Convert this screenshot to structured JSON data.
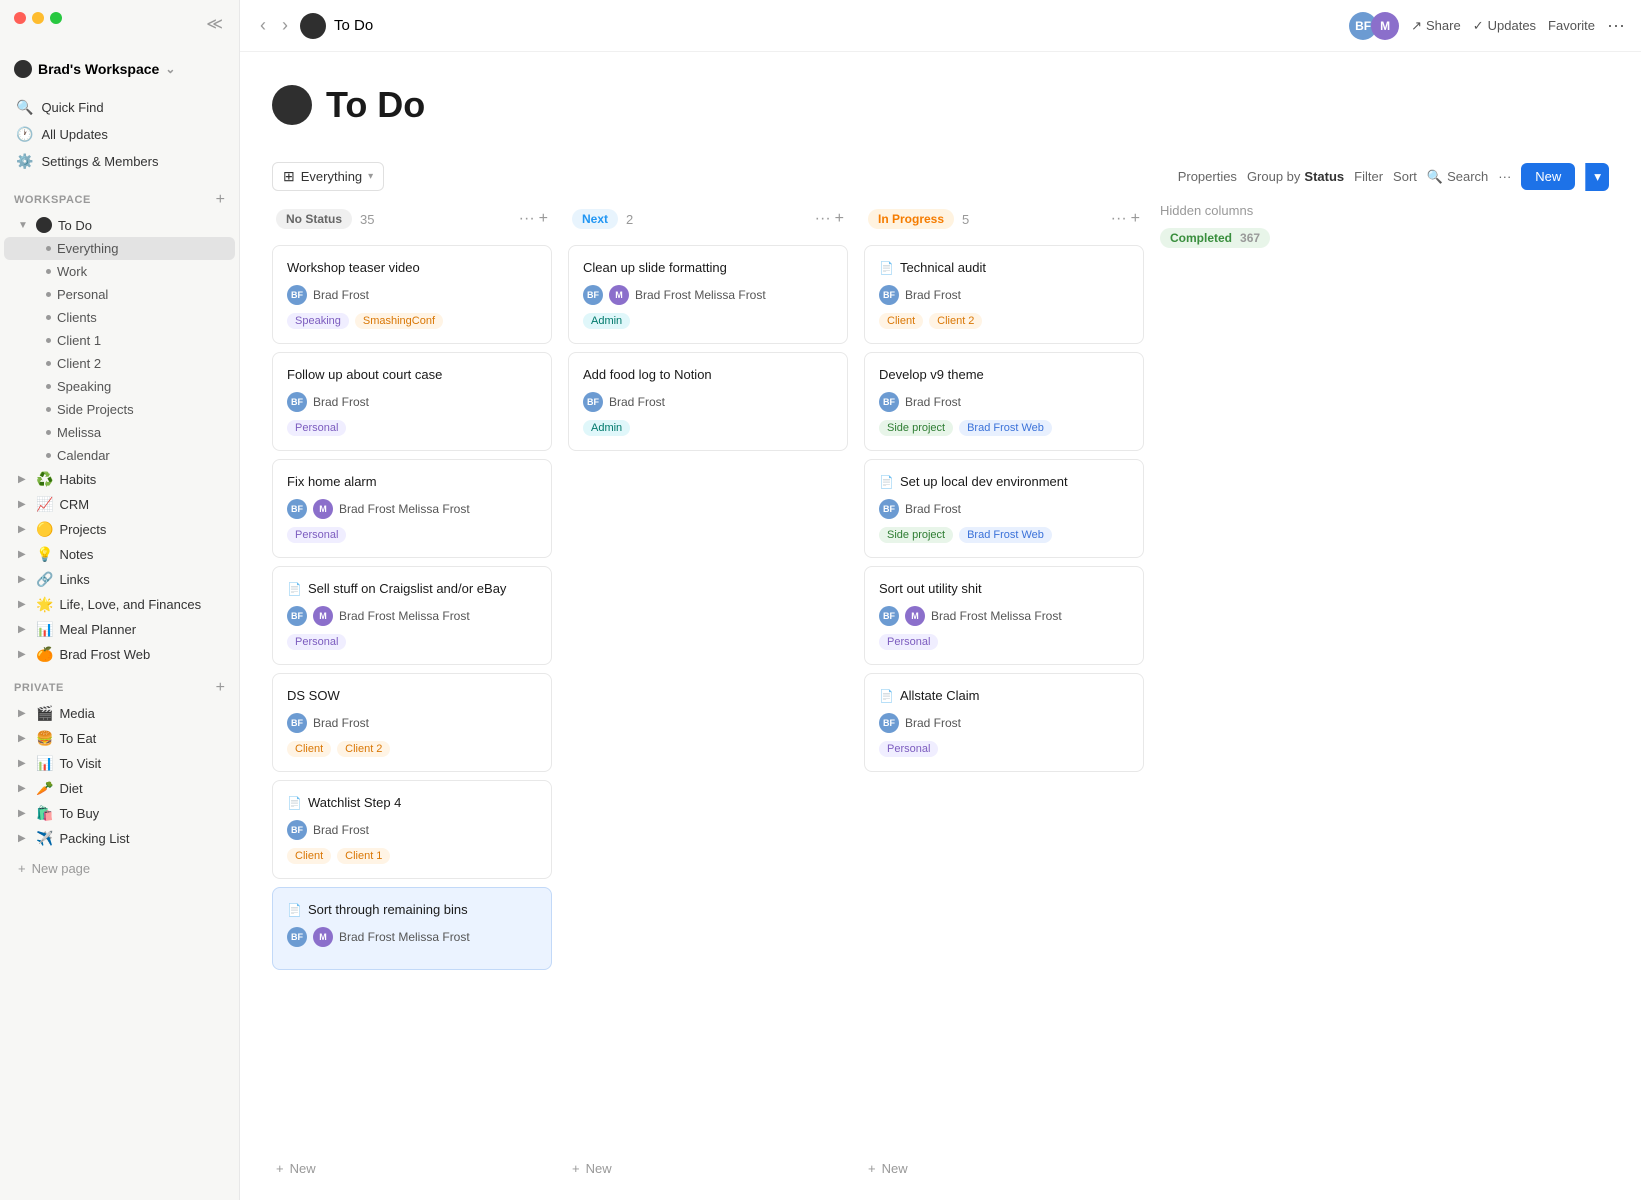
{
  "sidebar": {
    "workspace": "Brad's Workspace",
    "nav": [
      {
        "id": "quick-find",
        "icon": "🔍",
        "label": "Quick Find"
      },
      {
        "id": "all-updates",
        "icon": "🕐",
        "label": "All Updates"
      },
      {
        "id": "settings",
        "icon": "⚙️",
        "label": "Settings & Members"
      }
    ],
    "workspace_section": "WORKSPACE",
    "workspace_items": [
      {
        "id": "todo",
        "icon": "●",
        "label": "To Do",
        "expanded": true
      },
      {
        "id": "everything",
        "label": "Everything",
        "indent": true,
        "active": true
      },
      {
        "id": "work",
        "label": "Work",
        "indent": true
      },
      {
        "id": "personal",
        "label": "Personal",
        "indent": true
      },
      {
        "id": "clients",
        "label": "Clients",
        "indent": true
      },
      {
        "id": "client1",
        "label": "Client 1",
        "indent": true
      },
      {
        "id": "client2",
        "label": "Client 2",
        "indent": true
      },
      {
        "id": "speaking",
        "label": "Speaking",
        "indent": true
      },
      {
        "id": "sideprojects",
        "label": "Side Projects",
        "indent": true
      },
      {
        "id": "melissa",
        "label": "Melissa",
        "indent": true
      },
      {
        "id": "calendar",
        "label": "Calendar",
        "indent": true
      },
      {
        "id": "habits",
        "icon": "♻️",
        "label": "Habits"
      },
      {
        "id": "crm",
        "icon": "📈",
        "label": "CRM"
      },
      {
        "id": "projects",
        "icon": "🟡",
        "label": "Projects"
      },
      {
        "id": "notes",
        "icon": "💡",
        "label": "Notes"
      },
      {
        "id": "links",
        "icon": "🔗",
        "label": "Links"
      },
      {
        "id": "lifefinances",
        "icon": "🌟",
        "label": "Life, Love, and Finances"
      },
      {
        "id": "mealplanner",
        "icon": "📊",
        "label": "Meal Planner"
      },
      {
        "id": "bradfrostweb",
        "icon": "🍊",
        "label": "Brad Frost Web"
      }
    ],
    "private_section": "PRIVATE",
    "private_items": [
      {
        "id": "media",
        "icon": "🎬",
        "label": "Media"
      },
      {
        "id": "toeat",
        "icon": "🍔",
        "label": "To Eat"
      },
      {
        "id": "tovisit",
        "icon": "📊",
        "label": "To Visit"
      },
      {
        "id": "diet",
        "icon": "🥕",
        "label": "Diet"
      },
      {
        "id": "tobuy",
        "icon": "🛍️",
        "label": "To Buy"
      },
      {
        "id": "packinglist",
        "icon": "✈️",
        "label": "Packing List"
      }
    ],
    "new_page": "New page"
  },
  "topbar": {
    "title": "To Do",
    "share": "Share",
    "updates": "Updates",
    "favorite": "Favorite"
  },
  "page": {
    "title": "To Do",
    "view_label": "Everything",
    "properties": "Properties",
    "group_by": "Group by",
    "group_by_value": "Status",
    "filter": "Filter",
    "sort": "Sort",
    "search": "Search",
    "new": "New"
  },
  "columns": [
    {
      "id": "no-status",
      "status": "No Status",
      "status_type": "no-status",
      "count": 35,
      "cards": [
        {
          "id": "c1",
          "title": "Workshop teaser video",
          "users": [
            {
              "initials": "BF",
              "type": "bf"
            }
          ],
          "user_names": [
            "Brad Frost"
          ],
          "tags": [
            {
              "label": "Speaking",
              "type": "purple"
            },
            {
              "label": "SmashingConf",
              "type": "orange"
            }
          ]
        },
        {
          "id": "c2",
          "title": "Follow up about court case",
          "users": [
            {
              "initials": "BF",
              "type": "bf"
            }
          ],
          "user_names": [
            "Brad Frost"
          ],
          "tags": [
            {
              "label": "Personal",
              "type": "purple"
            }
          ]
        },
        {
          "id": "c3",
          "title": "Fix home alarm",
          "users": [
            {
              "initials": "BF",
              "type": "bf"
            },
            {
              "initials": "M",
              "type": "m"
            }
          ],
          "user_names": [
            "Brad Frost",
            "Melissa Frost"
          ],
          "tags": [
            {
              "label": "Personal",
              "type": "purple"
            }
          ]
        },
        {
          "id": "c4",
          "title": "Sell stuff on Craigslist and/or eBay",
          "has_icon": true,
          "users": [
            {
              "initials": "BF",
              "type": "bf"
            },
            {
              "initials": "M",
              "type": "m"
            }
          ],
          "user_names": [
            "Brad Frost",
            "Melissa Frost"
          ],
          "tags": [
            {
              "label": "Personal",
              "type": "purple"
            }
          ]
        },
        {
          "id": "c5",
          "title": "DS SOW",
          "users": [
            {
              "initials": "BF",
              "type": "bf"
            }
          ],
          "user_names": [
            "Brad Frost"
          ],
          "tags": [
            {
              "label": "Client",
              "type": "orange"
            },
            {
              "label": "Client 2",
              "type": "orange"
            }
          ]
        },
        {
          "id": "c6",
          "title": "Watchlist Step 4",
          "has_icon": true,
          "users": [
            {
              "initials": "BF",
              "type": "bf"
            }
          ],
          "user_names": [
            "Brad Frost"
          ],
          "tags": [
            {
              "label": "Client",
              "type": "orange"
            },
            {
              "label": "Client 1",
              "type": "orange"
            }
          ]
        },
        {
          "id": "c7",
          "title": "Sort through remaining bins",
          "has_icon": true,
          "highlighted": true,
          "users": [
            {
              "initials": "BF",
              "type": "bf"
            },
            {
              "initials": "M",
              "type": "m"
            }
          ],
          "user_names": [
            "Brad Frost",
            "Melissa Frost"
          ],
          "tags": []
        }
      ]
    },
    {
      "id": "next",
      "status": "Next",
      "status_type": "next",
      "count": 2,
      "cards": [
        {
          "id": "n1",
          "title": "Clean up slide formatting",
          "users": [
            {
              "initials": "BF",
              "type": "bf"
            },
            {
              "initials": "M",
              "type": "m"
            }
          ],
          "user_names": [
            "Brad Frost",
            "Melissa Frost"
          ],
          "tags": [
            {
              "label": "Admin",
              "type": "teal"
            }
          ]
        },
        {
          "id": "n2",
          "title": "Add food log to Notion",
          "users": [
            {
              "initials": "BF",
              "type": "bf"
            }
          ],
          "user_names": [
            "Brad Frost"
          ],
          "tags": [
            {
              "label": "Admin",
              "type": "teal"
            }
          ]
        }
      ]
    },
    {
      "id": "in-progress",
      "status": "In Progress",
      "status_type": "in-progress",
      "count": 5,
      "cards": [
        {
          "id": "ip1",
          "title": "Technical audit",
          "has_icon": true,
          "users": [
            {
              "initials": "BF",
              "type": "bf"
            }
          ],
          "user_names": [
            "Brad Frost"
          ],
          "tags": [
            {
              "label": "Client",
              "type": "orange"
            },
            {
              "label": "Client 2",
              "type": "orange"
            }
          ]
        },
        {
          "id": "ip2",
          "title": "Develop v9 theme",
          "users": [
            {
              "initials": "BF",
              "type": "bf"
            }
          ],
          "user_names": [
            "Brad Frost"
          ],
          "tags": [
            {
              "label": "Side project",
              "type": "green"
            },
            {
              "label": "Brad Frost Web",
              "type": "blue"
            }
          ]
        },
        {
          "id": "ip3",
          "title": "Set up local dev environment",
          "has_icon": true,
          "users": [
            {
              "initials": "BF",
              "type": "bf"
            }
          ],
          "user_names": [
            "Brad Frost"
          ],
          "tags": [
            {
              "label": "Side project",
              "type": "green"
            },
            {
              "label": "Brad Frost Web",
              "type": "blue"
            }
          ]
        },
        {
          "id": "ip4",
          "title": "Sort out utility shit",
          "users": [
            {
              "initials": "BF",
              "type": "bf"
            },
            {
              "initials": "M",
              "type": "m"
            }
          ],
          "user_names": [
            "Brad Frost",
            "Melissa Frost"
          ],
          "tags": [
            {
              "label": "Personal",
              "type": "purple"
            }
          ]
        },
        {
          "id": "ip5",
          "title": "Allstate Claim",
          "has_icon": true,
          "users": [
            {
              "initials": "BF",
              "type": "bf"
            }
          ],
          "user_names": [
            "Brad Frost"
          ],
          "tags": [
            {
              "label": "Personal",
              "type": "purple"
            }
          ]
        }
      ]
    }
  ],
  "hidden_columns": {
    "label": "Hidden columns",
    "completed": "Completed",
    "completed_count": 367
  }
}
